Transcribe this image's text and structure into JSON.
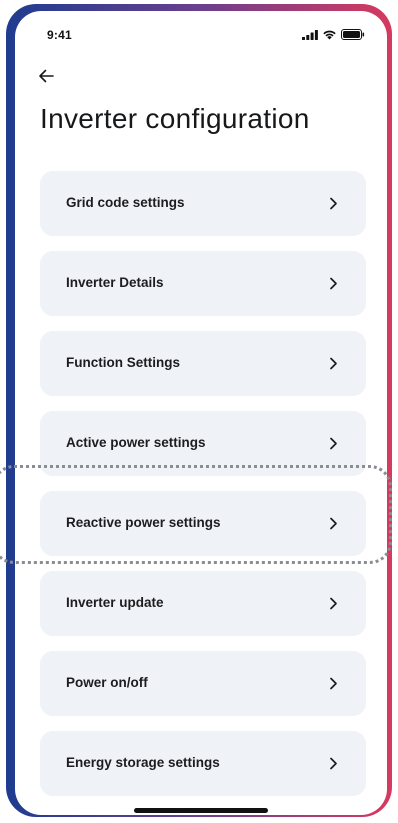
{
  "status_bar": {
    "time": "9:41"
  },
  "icons": {
    "back": "arrow-left-icon",
    "chevron": "chevron-right-icon",
    "signal": "signal-icon",
    "wifi": "wifi-icon",
    "battery": "battery-icon"
  },
  "header": {
    "title": "Inverter configuration"
  },
  "menu": {
    "items": [
      {
        "label": "Grid code settings"
      },
      {
        "label": "Inverter Details"
      },
      {
        "label": "Function Settings"
      },
      {
        "label": "Active power settings"
      },
      {
        "label": "Reactive power settings"
      },
      {
        "label": "Inverter update"
      },
      {
        "label": "Power on/off"
      },
      {
        "label": "Energy storage settings"
      }
    ]
  },
  "colors": {
    "frame_gradient_start": "#1f3c8f",
    "frame_gradient_end": "#d63a5f",
    "card_background": "#eff2f6",
    "text_primary": "#1c1d20",
    "highlight_border": "#8a8d93"
  }
}
